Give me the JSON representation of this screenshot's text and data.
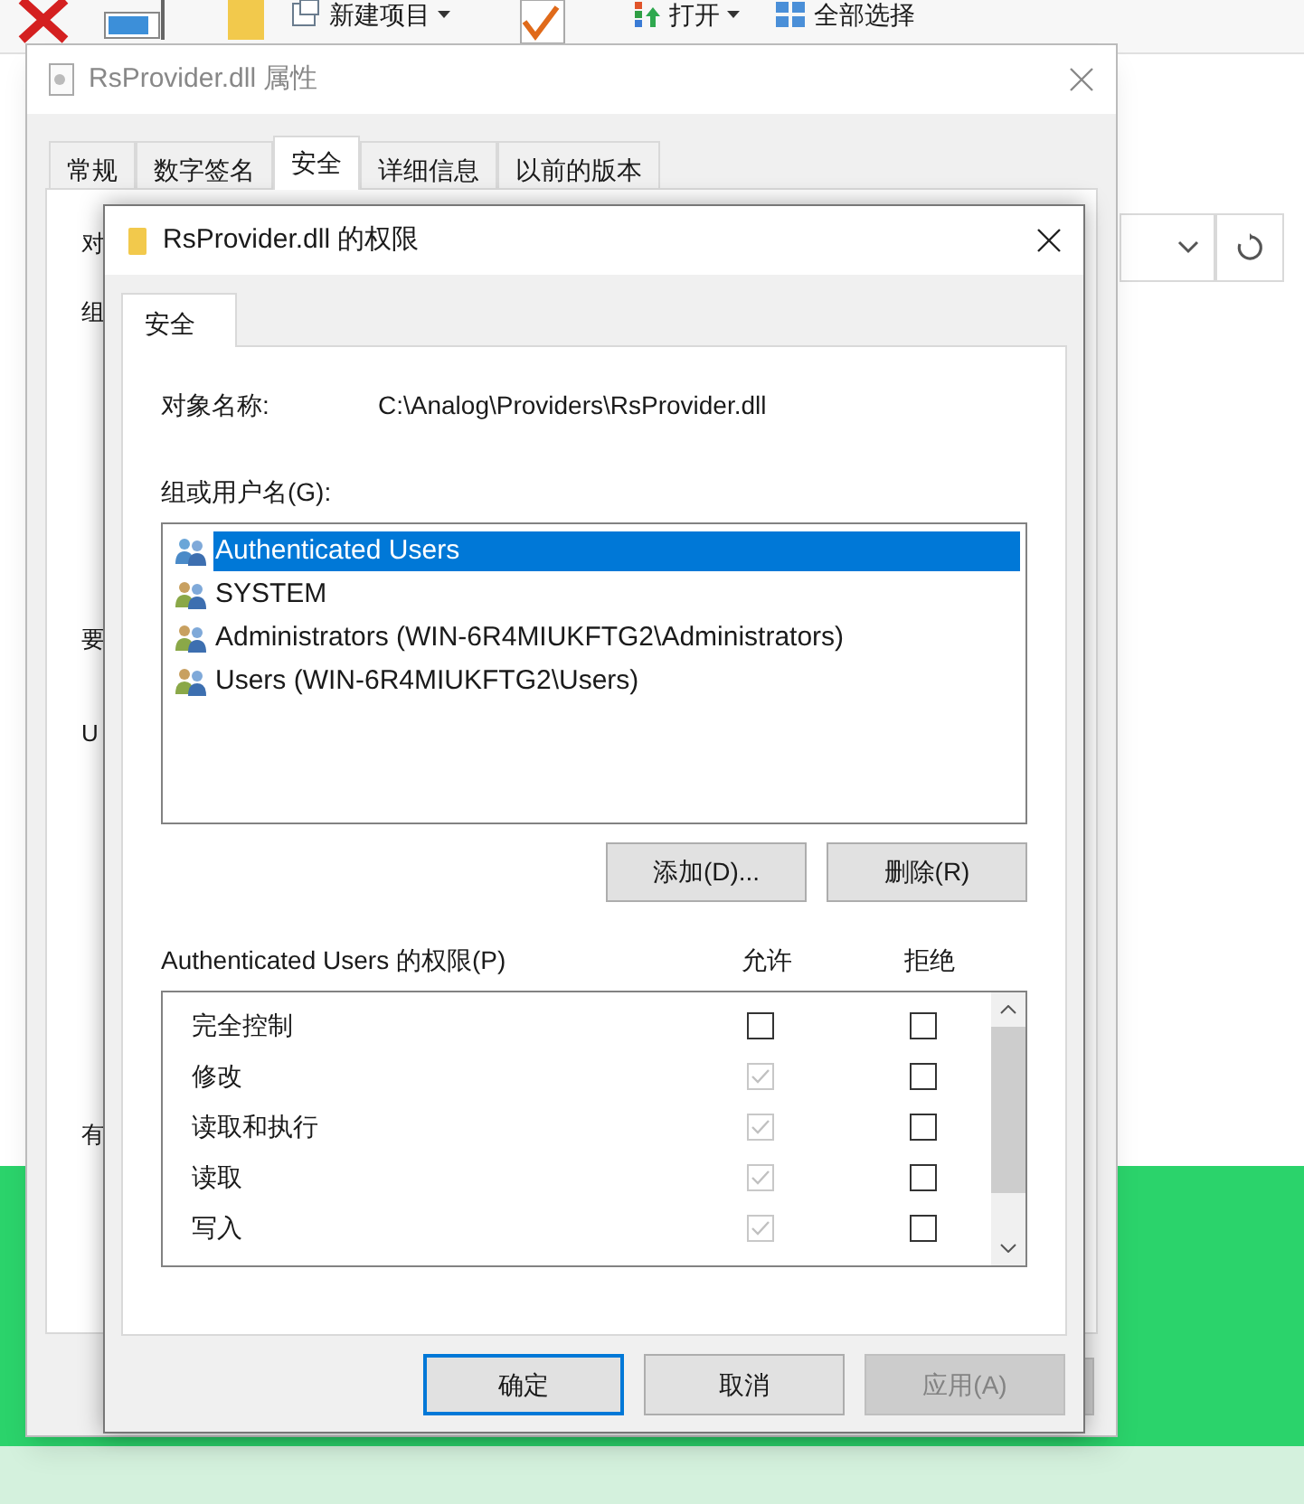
{
  "explorer": {
    "ribbon": [
      {
        "label": "新建项目",
        "kind": "new"
      },
      {
        "label": "打开",
        "kind": "open"
      },
      {
        "label": "全部选择",
        "kind": "select"
      }
    ]
  },
  "properties_window": {
    "title": "RsProvider.dll 属性",
    "tabs": [
      {
        "label": "常规",
        "selected": false
      },
      {
        "label": "数字签名",
        "selected": false
      },
      {
        "label": "安全",
        "selected": true
      },
      {
        "label": "详细信息",
        "selected": false
      },
      {
        "label": "以前的版本",
        "selected": false
      }
    ],
    "partial_labels": [
      "对",
      "组",
      "要",
      "U",
      "有"
    ]
  },
  "permissions_dialog": {
    "title": "RsProvider.dll 的权限",
    "tabs": [
      {
        "label": "安全",
        "selected": true
      }
    ],
    "object_name_label": "对象名称:",
    "object_name": "C:\\Analog\\Providers\\RsProvider.dll",
    "groups_label": "组或用户名(G):",
    "groups": [
      {
        "name": "Authenticated Users",
        "selected": true
      },
      {
        "name": "SYSTEM",
        "selected": false
      },
      {
        "name": "Administrators (WIN-6R4MIUKFTG2\\Administrators)",
        "selected": false
      },
      {
        "name": "Users (WIN-6R4MIUKFTG2\\Users)",
        "selected": false
      }
    ],
    "group_buttons": [
      "添加(D)...",
      "删除(R)"
    ],
    "permissions_label": "Authenticated Users 的权限(P)",
    "columns": [
      "允许",
      "拒绝"
    ],
    "permissions": [
      {
        "name": "完全控制",
        "allow": {
          "checked": false,
          "disabled": false
        },
        "deny": {
          "checked": false,
          "disabled": false
        }
      },
      {
        "name": "修改",
        "allow": {
          "checked": true,
          "disabled": true
        },
        "deny": {
          "checked": false,
          "disabled": false
        }
      },
      {
        "name": "读取和执行",
        "allow": {
          "checked": true,
          "disabled": true
        },
        "deny": {
          "checked": false,
          "disabled": false
        }
      },
      {
        "name": "读取",
        "allow": {
          "checked": true,
          "disabled": true
        },
        "deny": {
          "checked": false,
          "disabled": false
        }
      },
      {
        "name": "写入",
        "allow": {
          "checked": true,
          "disabled": true
        },
        "deny": {
          "checked": false,
          "disabled": false
        }
      }
    ],
    "footer_buttons": [
      {
        "label": "确定",
        "default": true,
        "disabled": false
      },
      {
        "label": "取消",
        "default": false,
        "disabled": false
      },
      {
        "label": "应用(A)",
        "default": false,
        "disabled": true
      }
    ]
  }
}
